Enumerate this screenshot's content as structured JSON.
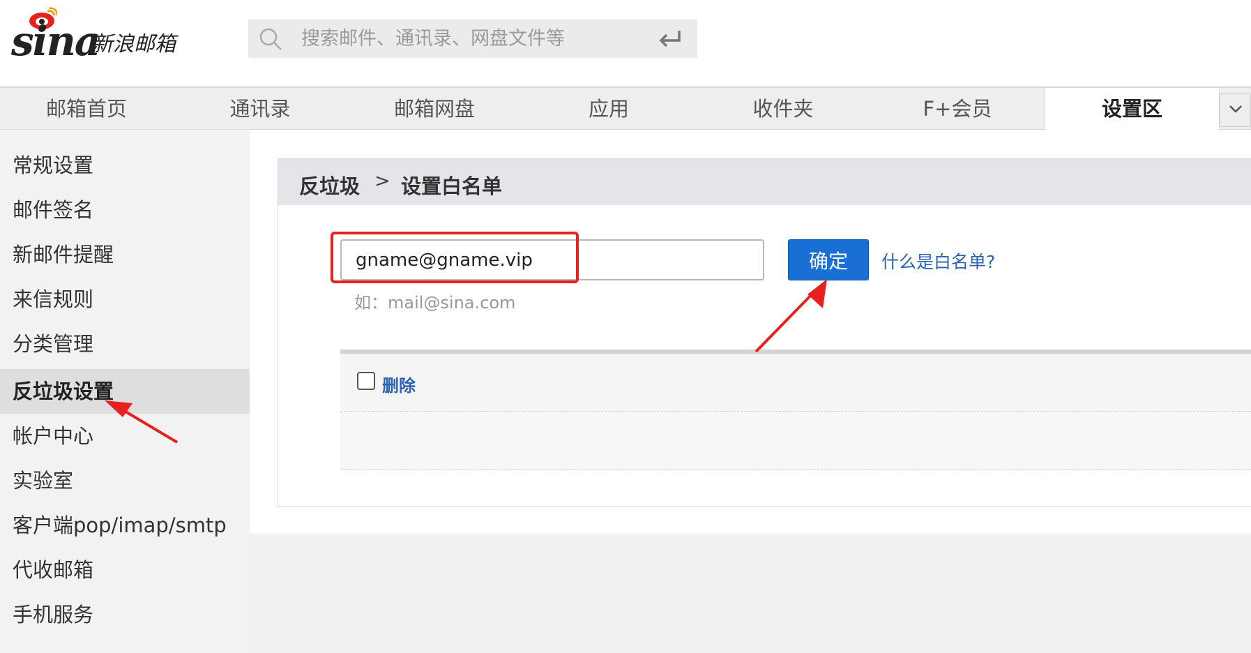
{
  "brand": {
    "logo_word": "sina",
    "name": "新浪邮箱"
  },
  "search": {
    "placeholder": "搜索邮件、通讯录、网盘文件等"
  },
  "nav": {
    "tabs": [
      {
        "label": "邮箱首页"
      },
      {
        "label": "通讯录"
      },
      {
        "label": "邮箱网盘"
      },
      {
        "label": "应用"
      },
      {
        "label": "收件夹"
      },
      {
        "label": "F+会员"
      },
      {
        "label": "设置区",
        "active": true
      }
    ]
  },
  "sidebar": {
    "items": [
      {
        "label": "常规设置"
      },
      {
        "label": "邮件签名"
      },
      {
        "label": "新邮件提醒"
      },
      {
        "label": "来信规则"
      },
      {
        "label": "分类管理"
      },
      {
        "label": "反垃圾设置",
        "active": true
      },
      {
        "label": "帐户中心"
      },
      {
        "label": "实验室"
      },
      {
        "label": "客户端pop/imap/smtp"
      },
      {
        "label": "代收邮箱"
      },
      {
        "label": "手机服务"
      }
    ]
  },
  "breadcrumb": {
    "parent": "反垃圾",
    "separator": ">",
    "current": "设置白名单"
  },
  "whitelist": {
    "input_value": "gname@gname.vip",
    "hint": "如：mail@sina.com",
    "confirm_label": "确定",
    "help_link": "什么是白名单?",
    "delete_label": "删除"
  },
  "colors": {
    "accent": "#1a6fd4",
    "link": "#2b62b5",
    "annotation": "#e8211f"
  },
  "icons": [
    "sina-eye-icon",
    "search-icon",
    "enter-icon",
    "chevron-down-icon",
    "checkbox-icon"
  ]
}
